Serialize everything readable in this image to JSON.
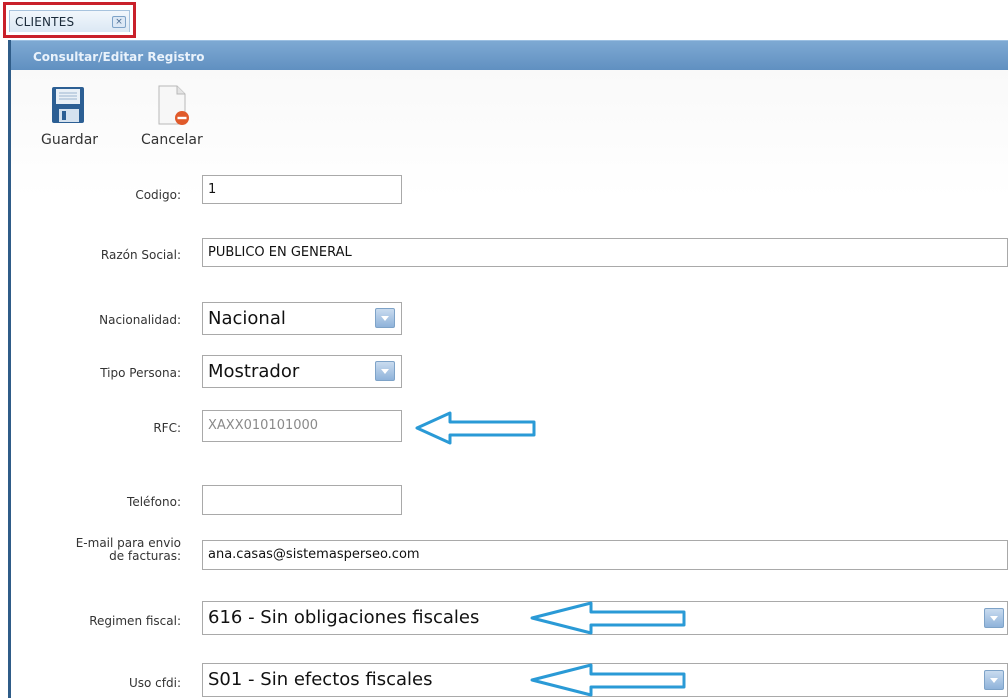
{
  "tab": {
    "label": "CLIENTES",
    "close_icon": "close-icon"
  },
  "window": {
    "title": "Consultar/Editar Registro"
  },
  "toolbar": {
    "save_label": "Guardar",
    "cancel_label": "Cancelar"
  },
  "form": {
    "codigo": {
      "label": "Codigo:",
      "value": "1"
    },
    "razon_social": {
      "label": "Razón Social:",
      "value": "PUBLICO EN GENERAL"
    },
    "nacionalidad": {
      "label": "Nacionalidad:",
      "value": "Nacional"
    },
    "tipo_persona": {
      "label": "Tipo Persona:",
      "value": "Mostrador"
    },
    "rfc": {
      "label": "RFC:",
      "value": "XAXX010101000"
    },
    "telefono": {
      "label": "Teléfono:",
      "value": ""
    },
    "email": {
      "label_line1": "E-mail para envio",
      "label_line2": "de facturas:",
      "value": "ana.casas@sistemasperseo.com"
    },
    "regimen_fiscal": {
      "label": "Regimen fiscal:",
      "value": "616 - Sin obligaciones fiscales"
    },
    "uso_cfdi": {
      "label": "Uso cfdi:",
      "value": "S01 - Sin efectos fiscales"
    }
  },
  "colors": {
    "accent": "#5f8fc0",
    "tab_border": "#c9202a",
    "annotation_arrow": "#2a9ad6"
  }
}
